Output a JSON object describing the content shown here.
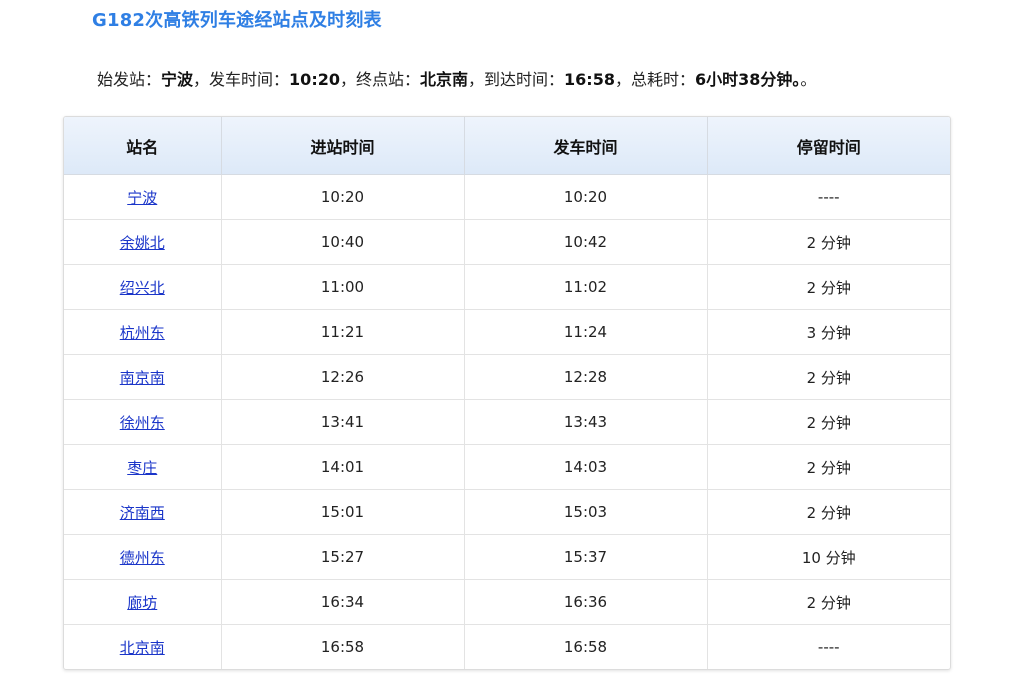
{
  "title": "G182次高铁列车途经站点及时刻表",
  "summary": {
    "origin_label": "始发站：",
    "origin": "宁波",
    "sep1": "，发车时间：",
    "depart_time": "10:20",
    "sep2": "，终点站：",
    "terminus": "北京南",
    "sep3": "，到达时间：",
    "arrive_time": "16:58",
    "sep4": "，总耗时：",
    "duration": "6小时38分钟。",
    "tail": "。"
  },
  "table": {
    "headers": [
      "站名",
      "进站时间",
      "发车时间",
      "停留时间"
    ],
    "rows": [
      {
        "station": "宁波",
        "arrive": "10:20",
        "depart": "10:20",
        "stop": "----"
      },
      {
        "station": "余姚北",
        "arrive": "10:40",
        "depart": "10:42",
        "stop": "2 分钟"
      },
      {
        "station": "绍兴北",
        "arrive": "11:00",
        "depart": "11:02",
        "stop": "2 分钟"
      },
      {
        "station": "杭州东",
        "arrive": "11:21",
        "depart": "11:24",
        "stop": "3 分钟"
      },
      {
        "station": "南京南",
        "arrive": "12:26",
        "depart": "12:28",
        "stop": "2 分钟"
      },
      {
        "station": "徐州东",
        "arrive": "13:41",
        "depart": "13:43",
        "stop": "2 分钟"
      },
      {
        "station": "枣庄",
        "arrive": "14:01",
        "depart": "14:03",
        "stop": "2 分钟"
      },
      {
        "station": "济南西",
        "arrive": "15:01",
        "depart": "15:03",
        "stop": "2 分钟"
      },
      {
        "station": "德州东",
        "arrive": "15:27",
        "depart": "15:37",
        "stop": "10 分钟"
      },
      {
        "station": "廊坊",
        "arrive": "16:34",
        "depart": "16:36",
        "stop": "2 分钟"
      },
      {
        "station": "北京南",
        "arrive": "16:58",
        "depart": "16:58",
        "stop": "----"
      }
    ]
  },
  "colors": {
    "title": "#2f7fe4",
    "link": "#1a35c9",
    "header_bg": "#dde9f8"
  }
}
